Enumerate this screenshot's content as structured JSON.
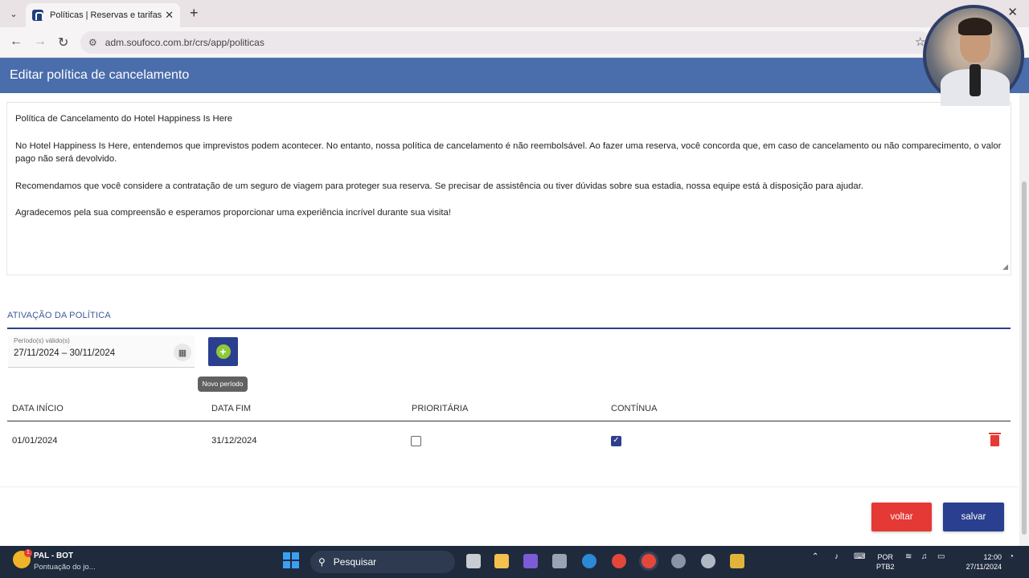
{
  "browser": {
    "tab_title": "Políticas | Reservas e tarifas",
    "url": "adm.soufoco.com.br/crs/app/politicas"
  },
  "header": {
    "title": "Editar política de cancelamento"
  },
  "editor": {
    "paragraphs": [
      "Política de Cancelamento do Hotel Happiness Is Here",
      "No Hotel Happiness Is Here, entendemos que imprevistos podem acontecer. No entanto, nossa política de cancelamento é não reembolsável. Ao fazer uma reserva, você concorda que, em caso de cancelamento ou não comparecimento, o valor pago não será devolvido.",
      "Recomendamos que você considere a contratação de um seguro de viagem para proteger sua reserva. Se precisar de assistência ou tiver dúvidas sobre sua estadia, nossa equipe está à disposição para ajudar.",
      "Agradecemos pela sua compreensão e esperamos proporcionar uma experiência incrível durante sua visita!"
    ]
  },
  "activation": {
    "section_title": "ATIVAÇÃO DA POLÍTICA",
    "period_label": "Período(s) válido(s)",
    "period_value": "27/11/2024 – 30/11/2024",
    "new_period_tooltip": "Novo período"
  },
  "table": {
    "headers": [
      "DATA INÍCIO",
      "DATA FIM",
      "PRIORITÁRIA",
      "CONTÍNUA"
    ],
    "rows": [
      {
        "start": "01/01/2024",
        "end": "31/12/2024",
        "priority": false,
        "continuous": true
      }
    ]
  },
  "actions": {
    "back_label": "voltar",
    "save_label": "salvar",
    "back_color": "#e53935",
    "save_color": "#2a3f8f"
  },
  "taskbar": {
    "app_title": "PAL - BOT",
    "app_subtitle": "Pontuação do jo...",
    "badge": "1",
    "search_placeholder": "Pesquisar",
    "lang_line1": "POR",
    "lang_line2": "PTB2",
    "time": "12:00",
    "date": "27/11/2024"
  }
}
